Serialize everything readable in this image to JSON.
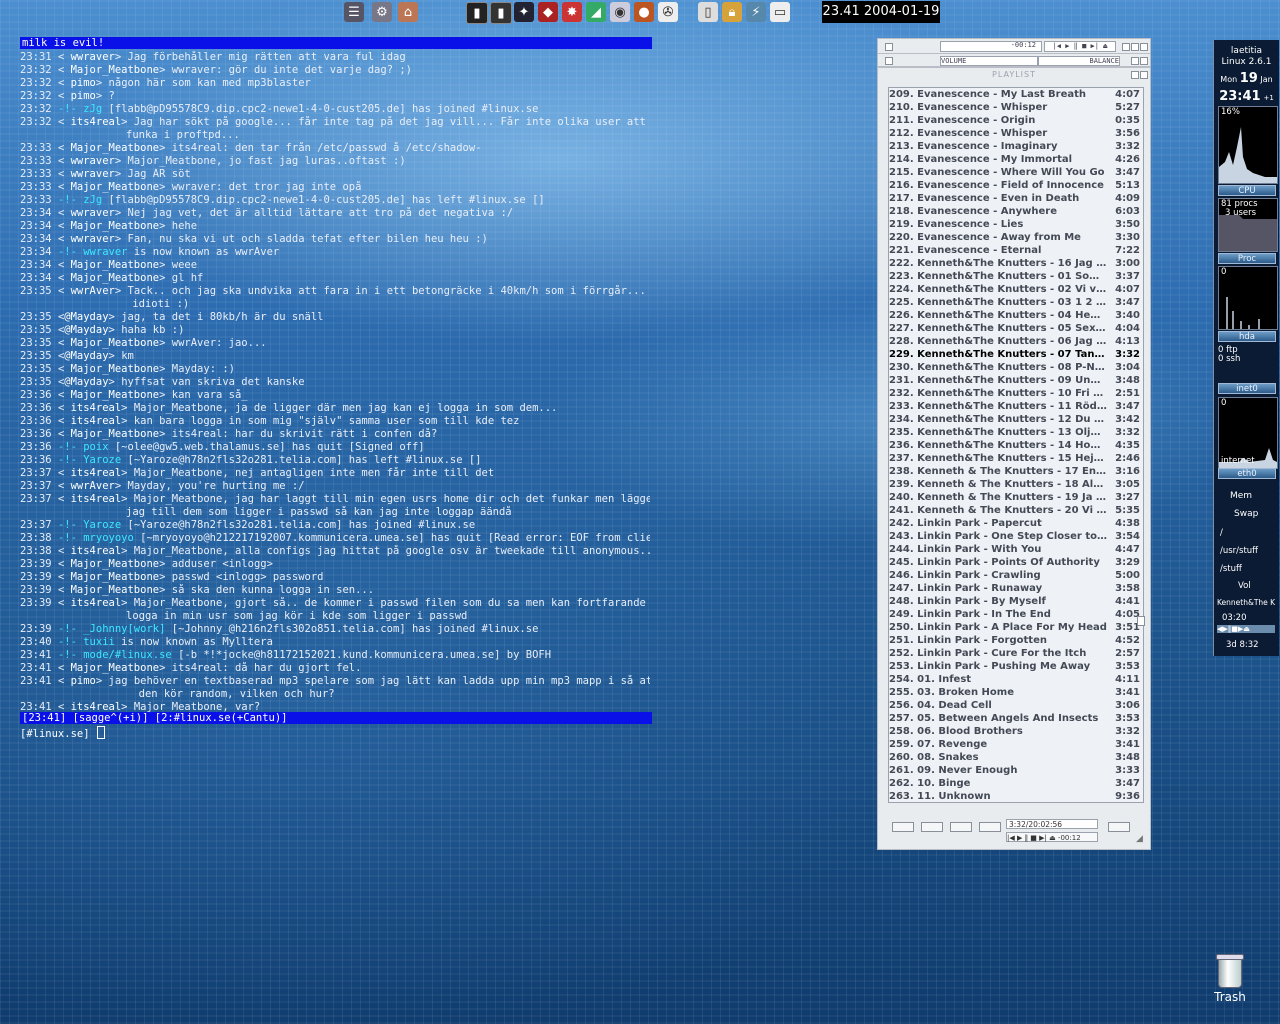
{
  "desktop": {
    "trash_label": "Trash"
  },
  "taskbar": {
    "clock": "23.41 2004-01-19",
    "launchers": [
      "menu-icon",
      "settings-icon",
      "home-icon",
      "terminal-icon",
      "console-icon",
      "tux-icon",
      "redhat-icon",
      "mozilla-icon",
      "lamp-icon",
      "xmms-icon",
      "movie-icon",
      "clipboard-icon",
      "lock-icon",
      "network-icon",
      "note-icon"
    ]
  },
  "irc": {
    "topic": "milk is evil!",
    "lines": [
      {
        "t": "23:31",
        "b": "< ",
        "n": "wwraver",
        "a": "> ",
        "m": "Jag förbehåller mig rätten att vara ful idag",
        "k": "n"
      },
      {
        "t": "23:32",
        "b": "< ",
        "n": "Major_Meatbone",
        "a": "> ",
        "m": "wwraver: gör du inte det varje dag? ;)",
        "k": "n"
      },
      {
        "t": "23:32",
        "b": "< ",
        "n": "pimo",
        "a": "> ",
        "m": "någon här som kan med mp3blaster",
        "k": "n"
      },
      {
        "t": "23:32",
        "b": "< ",
        "n": "pimo",
        "a": "> ",
        "m": "?",
        "k": "n"
      },
      {
        "t": "23:32",
        "b": "-!- ",
        "n": "zJg",
        "a": " ",
        "m": "[flabb@pD95578C9.dip.cpc2-newe1-4-0-cust205.de] has joined #linux.se",
        "k": "s"
      },
      {
        "t": "23:32",
        "b": "< ",
        "n": "its4real",
        "a": "> ",
        "m": "Jag har sökt på google... får inte tag på det jag vill... Får inte olika user att",
        "k": "n"
      },
      {
        "t": "",
        "b": "",
        "n": "",
        "a": "",
        "m": "funka i proftpd...",
        "k": "c"
      },
      {
        "t": "23:33",
        "b": "< ",
        "n": "Major_Meatbone",
        "a": "> ",
        "m": "its4real: den tar från /etc/passwd å /etc/shadow-",
        "k": "n"
      },
      {
        "t": "23:33",
        "b": "< ",
        "n": "wwraver",
        "a": "> ",
        "m": "Major_Meatbone, jo fast jag luras..oftast :)",
        "k": "n"
      },
      {
        "t": "23:33",
        "b": "< ",
        "n": "wwraver",
        "a": "> ",
        "m": "Jag ÄR söt",
        "k": "n"
      },
      {
        "t": "23:33",
        "b": "< ",
        "n": "Major_Meatbone",
        "a": "> ",
        "m": "wwraver: det tror jag inte opå",
        "k": "n"
      },
      {
        "t": "23:33",
        "b": "-!- ",
        "n": "zJg",
        "a": " ",
        "m": "[flabb@pD95578C9.dip.cpc2-newe1-4-0-cust205.de] has left #linux.se []",
        "k": "s"
      },
      {
        "t": "23:34",
        "b": "< ",
        "n": "wwraver",
        "a": "> ",
        "m": "Nej jag vet, det är alltid lättare att tro på det negativa :/",
        "k": "n"
      },
      {
        "t": "23:34",
        "b": "< ",
        "n": "Major_Meatbone",
        "a": "> ",
        "m": "hehe",
        "k": "n"
      },
      {
        "t": "23:34",
        "b": "< ",
        "n": "wwraver",
        "a": "> ",
        "m": "Fan, nu ska vi ut och sladda tefat efter bilen heu heu :)",
        "k": "n"
      },
      {
        "t": "23:34",
        "b": "-!- ",
        "n": "wwraver",
        "a": " ",
        "m": "is now known as wwrAver",
        "k": "s"
      },
      {
        "t": "23:34",
        "b": "< ",
        "n": "Major_Meatbone",
        "a": "> ",
        "m": "weee",
        "k": "n"
      },
      {
        "t": "23:34",
        "b": "< ",
        "n": "Major_Meatbone",
        "a": "> ",
        "m": "gl hf",
        "k": "n"
      },
      {
        "t": "23:35",
        "b": "< ",
        "n": "wwrAver",
        "a": "> ",
        "m": "Tack.. och jag ska undvika att fara in i ett betongräcke i 40km/h som i förrgår...",
        "k": "n"
      },
      {
        "t": "",
        "b": "",
        "n": "",
        "a": "",
        "m": " idioti :)",
        "k": "c"
      },
      {
        "t": "23:35",
        "b": "<",
        "n": "@Mayday",
        "a": "> ",
        "m": "jag, ta det i 80kb/h är du snäll",
        "k": "n"
      },
      {
        "t": "23:35",
        "b": "<",
        "n": "@Mayday",
        "a": "> ",
        "m": "haha kb :)",
        "k": "n"
      },
      {
        "t": "23:35",
        "b": "< ",
        "n": "Major_Meatbone",
        "a": "> ",
        "m": "wwrAver: jao...",
        "k": "n"
      },
      {
        "t": "23:35",
        "b": "<",
        "n": "@Mayday",
        "a": "> ",
        "m": "km",
        "k": "n"
      },
      {
        "t": "23:35",
        "b": "< ",
        "n": "Major_Meatbone",
        "a": "> ",
        "m": "Mayday: :)",
        "k": "n"
      },
      {
        "t": "23:35",
        "b": "<",
        "n": "@Mayday",
        "a": "> ",
        "m": "hyffsat van skriva det kanske",
        "k": "n"
      },
      {
        "t": "23:36",
        "b": "< ",
        "n": "Major_Meatbone",
        "a": "> ",
        "m": "kan vara så_",
        "k": "n"
      },
      {
        "t": "23:36",
        "b": "< ",
        "n": "its4real",
        "a": "> ",
        "m": "Major_Meatbone, ja de ligger där men jag kan ej logga in som dem...",
        "k": "n"
      },
      {
        "t": "23:36",
        "b": "< ",
        "n": "its4real",
        "a": "> ",
        "m": "kan bara logga in som mig \"själv\" samma user som till kde tez",
        "k": "n"
      },
      {
        "t": "23:36",
        "b": "< ",
        "n": "Major_Meatbone",
        "a": "> ",
        "m": "its4real: har du skrivit rätt i confen då?",
        "k": "n"
      },
      {
        "t": "23:36",
        "b": "-!- ",
        "n": "poix",
        "a": " ",
        "m": "[~olee@gw5.web.thalamus.se] has quit [Signed off]",
        "k": "s"
      },
      {
        "t": "23:36",
        "b": "-!- ",
        "n": "Yaroze",
        "a": " ",
        "m": "[~Yaroze@h78n2fls32o281.telia.com] has left #linux.se []",
        "k": "s"
      },
      {
        "t": "23:37",
        "b": "< ",
        "n": "its4real",
        "a": "> ",
        "m": "Major_Meatbone, nej antagligen inte men får inte till det",
        "k": "n"
      },
      {
        "t": "23:37",
        "b": "< ",
        "n": "wwrAver",
        "a": "> ",
        "m": "Mayday, you're hurting me :/",
        "k": "n"
      },
      {
        "t": "23:37",
        "b": "< ",
        "n": "its4real",
        "a": "> ",
        "m": "Major_Meatbone, jag har laggt till min egen usrs home dir och det funkar men lägger",
        "k": "n"
      },
      {
        "t": "",
        "b": "",
        "n": "",
        "a": "",
        "m": "jag till dem som ligger i passwd så kan jag inte loggap äändå",
        "k": "c"
      },
      {
        "t": "23:37",
        "b": "-!- ",
        "n": "Yaroze",
        "a": " ",
        "m": "[~Yaroze@h78n2fls32o281.telia.com] has joined #linux.se",
        "k": "s"
      },
      {
        "t": "23:38",
        "b": "-!- ",
        "n": "mryoyoyo",
        "a": " ",
        "m": "[~mryoyoyo@h212217192007.kommunicera.umea.se] has quit [Read error: EOF from client]",
        "k": "s"
      },
      {
        "t": "23:38",
        "b": "< ",
        "n": "its4real",
        "a": "> ",
        "m": "Major_Meatbone, alla configs jag hittat på google osv är tweekade till anonymous...",
        "k": "n"
      },
      {
        "t": "23:39",
        "b": "< ",
        "n": "Major_Meatbone",
        "a": "> ",
        "m": "adduser <inlogg>",
        "k": "n"
      },
      {
        "t": "23:39",
        "b": "< ",
        "n": "Major_Meatbone",
        "a": "> ",
        "m": "passwd <inlogg> password",
        "k": "n"
      },
      {
        "t": "23:39",
        "b": "< ",
        "n": "Major_Meatbone",
        "a": "> ",
        "m": "så ska den kunna logga in sen...",
        "k": "n"
      },
      {
        "t": "23:39",
        "b": "< ",
        "n": "its4real",
        "a": "> ",
        "m": "Major_Meatbone, gjort så.. de kommer i passwd filen som du sa men kan fortfarande bara",
        "k": "n"
      },
      {
        "t": "",
        "b": "",
        "n": "",
        "a": "",
        "m": "logga in min usr som jag kör i kde som ligger i passwd",
        "k": "c"
      },
      {
        "t": "23:39",
        "b": "-!- ",
        "n": "_Johnny[work]",
        "a": " ",
        "m": "[~Johnny_@h216n2fls302o851.telia.com] has joined #linux.se",
        "k": "s"
      },
      {
        "t": "23:40",
        "b": "-!- ",
        "n": "tuxii",
        "a": " ",
        "m": "is now known as Mylltera",
        "k": "s"
      },
      {
        "t": "23:41",
        "b": "-!- ",
        "n": "mode/#linux.se",
        "a": " ",
        "m": "[-b *!*jocke@h81172152021.kund.kommunicera.umea.se] by BOFH",
        "k": "s"
      },
      {
        "t": "23:41",
        "b": "< ",
        "n": "Major_Meatbone",
        "a": "> ",
        "m": "its4real: då har du gjort fel.",
        "k": "n"
      },
      {
        "t": "23:41",
        "b": "< ",
        "n": "pimo",
        "a": "> ",
        "m": "jag behöver en textbaserad mp3 spelare som jag lätt kan ladda upp min mp3 mapp i så att",
        "k": "n"
      },
      {
        "t": "",
        "b": "",
        "n": "",
        "a": "",
        "m": "  den kör random, vilken och hur?",
        "k": "c"
      },
      {
        "t": "23:41",
        "b": "< ",
        "n": "its4real",
        "a": "> ",
        "m": "Major_Meatbone, var?",
        "k": "n"
      }
    ],
    "statusbar": "[23:41] [sagge^(+i)] [2:#linux.se(+Cantu)]",
    "input_prompt": "[#linux.se] "
  },
  "xmms": {
    "main_time": "-00:12",
    "eq_left": "VOLUME",
    "eq_right": "BALANCE",
    "playlist_title": "PLAYLIST",
    "current_index": 20,
    "tracks": [
      {
        "t": "209. Evanescence - My Last Breath",
        "d": "4:07"
      },
      {
        "t": "210. Evanescence - Whisper",
        "d": "5:27"
      },
      {
        "t": "211. Evanescence - Origin",
        "d": "0:35"
      },
      {
        "t": "212. Evanescence - Whisper",
        "d": "3:56"
      },
      {
        "t": "213. Evanescence - Imaginary",
        "d": "3:32"
      },
      {
        "t": "214. Evanescence - My Immortal",
        "d": "4:26"
      },
      {
        "t": "215. Evanescence - Where Will You Go",
        "d": "3:47"
      },
      {
        "t": "216. Evanescence - Field of Innocence",
        "d": "5:13"
      },
      {
        "t": "217. Evanescence - Even in Death",
        "d": "4:09"
      },
      {
        "t": "218. Evanescence - Anywhere",
        "d": "6:03"
      },
      {
        "t": "219. Evanescence - Lies",
        "d": "3:50"
      },
      {
        "t": "220. Evanescence - Away from Me",
        "d": "3:30"
      },
      {
        "t": "221. Evanescence - Eternal",
        "d": "7:22"
      },
      {
        "t": "222. Kenneth&The Knutters - 16 Jag kan ...",
        "d": "3:00"
      },
      {
        "t": "223. Kenneth&The Knutters - 01 Som en r...",
        "d": "3:37"
      },
      {
        "t": "224. Kenneth&The Knutters - 02 Vi vill ha...",
        "d": "4:07"
      },
      {
        "t": "225. Kenneth&The Knutters - 03 1 2 3 4 ...",
        "d": "3:47"
      },
      {
        "t": "226. Kenneth&The Knutters - 04 Hem till...",
        "d": "3:40"
      },
      {
        "t": "227. Kenneth&The Knutters - 05 Sexma...",
        "d": "4:04"
      },
      {
        "t": "228. Kenneth&The Knutters - 06 Jag vill h...",
        "d": "4:13"
      },
      {
        "t": "229. Kenneth&The Knutters - 07 Tankad, ...",
        "d": "3:32"
      },
      {
        "t": "230. Kenneth&The Knutters - 08 P-Nissar",
        "d": "3:04"
      },
      {
        "t": "231. Kenneth&The Knutters - 09 Ung, villi...",
        "d": "3:48"
      },
      {
        "t": "232. Kenneth&The Knutters - 10 Fri fart",
        "d": "2:51"
      },
      {
        "t": "233. Kenneth&The Knutters - 11 Rödljus...",
        "d": "3:47"
      },
      {
        "t": "234. Kenneth&The Knutters - 12 Du vibrer...",
        "d": "3:42"
      },
      {
        "t": "235. Kenneth&The Knutters - 13 Oljad blixt",
        "d": "3:32"
      },
      {
        "t": "236. Kenneth&The Knutters - 14 Hon sitte...",
        "d": "4:35"
      },
      {
        "t": "237. Kenneth&The Knutters - 15 Hej se p...",
        "d": "2:46"
      },
      {
        "t": "238. Kenneth & The Knutters - 17 En vild, ...",
        "d": "3:16"
      },
      {
        "t": "239. Kenneth & The Knutters - 18 Algjakt...",
        "d": "3:05"
      },
      {
        "t": "240. Kenneth & The Knutters - 19 Ja ja ja...",
        "d": "3:27"
      },
      {
        "t": "241. Kenneth & The Knutters - 20 Vi ska ...",
        "d": "5:35"
      },
      {
        "t": "242. Linkin Park - Papercut",
        "d": "4:38"
      },
      {
        "t": "243. Linkin Park - One Step Closer to You",
        "d": "3:54"
      },
      {
        "t": "244. Linkin Park - With You",
        "d": "4:47"
      },
      {
        "t": "245. Linkin Park - Points Of Authority",
        "d": "3:29"
      },
      {
        "t": "246. Linkin Park - Crawling",
        "d": "5:00"
      },
      {
        "t": "247. Linkin Park - Runaway",
        "d": "3:58"
      },
      {
        "t": "248. Linkin Park - By Myself",
        "d": "4:41"
      },
      {
        "t": "249. Linkin Park - In The End",
        "d": "4:05"
      },
      {
        "t": "250. Linkin Park - A Place For My Head",
        "d": "3:51"
      },
      {
        "t": "251. Linkin Park - Forgotten",
        "d": "4:52"
      },
      {
        "t": "252. Linkin Park - Cure For the Itch",
        "d": "2:57"
      },
      {
        "t": "253. Linkin Park - Pushing Me Away",
        "d": "3:53"
      },
      {
        "t": "254. 01. Infest",
        "d": "4:11"
      },
      {
        "t": "255. 03. Broken Home",
        "d": "3:41"
      },
      {
        "t": "256. 04. Dead Cell",
        "d": "3:06"
      },
      {
        "t": "257. 05. Between Angels And Insects",
        "d": "3:53"
      },
      {
        "t": "258. 06. Blood Brothers",
        "d": "3:32"
      },
      {
        "t": "259. 07. Revenge",
        "d": "3:41"
      },
      {
        "t": "260. 08. Snakes",
        "d": "3:48"
      },
      {
        "t": "261. 09. Never Enough",
        "d": "3:33"
      },
      {
        "t": "262. 10. Binge",
        "d": "3:47"
      },
      {
        "t": "263. 11. Unknown",
        "d": "9:36"
      }
    ],
    "pl_time": "3:32/20:02:56",
    "pl_counter": "-00:12"
  },
  "gkrellm": {
    "host": "laetitia",
    "kernel": "Linux 2.6.1",
    "day": "Mon",
    "date": "19",
    "month": "Jan",
    "time": "23:41",
    "tz": "+1",
    "cpu_pct": "16%",
    "cpu_label": "CPU",
    "procs": "81 procs",
    "users": "3 users",
    "proc_label": "Proc",
    "hda_zero": "0",
    "hda_label": "hda",
    "ppp_a": "0 ftp",
    "ppp_b": "0 ssh",
    "inet_label": "inet0",
    "eth_zero": "0",
    "internet": "internet",
    "eth_label": "eth0",
    "mem_label": "Mem",
    "swap_label": "Swap",
    "fs": [
      "/",
      "/usr/stuff",
      "/stuff"
    ],
    "vol_label": "Vol",
    "track_scroll": "Kenneth&The K",
    "xmms_time": "03:20",
    "uptime": "3d 8:32"
  }
}
